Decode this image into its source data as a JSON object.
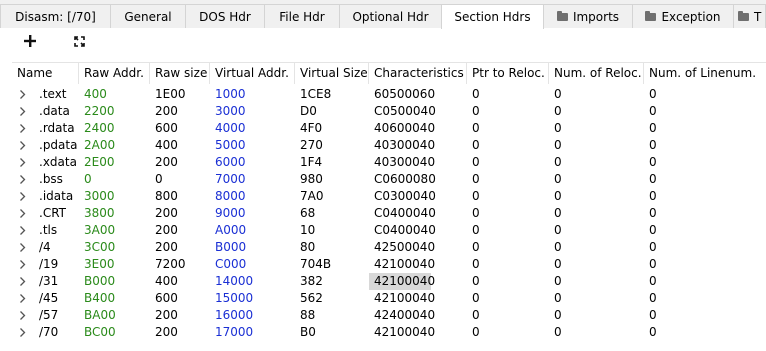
{
  "tabs": [
    {
      "label": "Disasm: [/70]",
      "icon": null,
      "active": false
    },
    {
      "label": "General",
      "icon": null,
      "active": false
    },
    {
      "label": "DOS Hdr",
      "icon": null,
      "active": false
    },
    {
      "label": "File Hdr",
      "icon": null,
      "active": false
    },
    {
      "label": "Optional Hdr",
      "icon": null,
      "active": false
    },
    {
      "label": "Section Hdrs",
      "icon": null,
      "active": true
    },
    {
      "label": "Imports",
      "icon": "folder-icon",
      "active": false
    },
    {
      "label": "Exception",
      "icon": "folder-icon",
      "active": false
    },
    {
      "label": "T",
      "icon": "folder-icon",
      "active": false
    }
  ],
  "toolbar": {
    "add_icon": "plus-icon",
    "fit_icon": "expand-arrows-icon"
  },
  "table": {
    "columns": [
      "Name",
      "Raw Addr.",
      "Raw size",
      "Virtual Addr.",
      "Virtual Size",
      "Characteristics",
      "Ptr to Reloc.",
      "Num. of Reloc.",
      "Num. of Linenum."
    ],
    "rows": [
      [
        ".text",
        "400",
        "1E00",
        "1000",
        "1CE8",
        "60500060",
        "0",
        "0",
        "0"
      ],
      [
        ".data",
        "2200",
        "200",
        "3000",
        "D0",
        "C0500040",
        "0",
        "0",
        "0"
      ],
      [
        ".rdata",
        "2400",
        "600",
        "4000",
        "4F0",
        "40600040",
        "0",
        "0",
        "0"
      ],
      [
        ".pdata",
        "2A00",
        "400",
        "5000",
        "270",
        "40300040",
        "0",
        "0",
        "0"
      ],
      [
        ".xdata",
        "2E00",
        "200",
        "6000",
        "1F4",
        "40300040",
        "0",
        "0",
        "0"
      ],
      [
        ".bss",
        "0",
        "0",
        "7000",
        "980",
        "C0600080",
        "0",
        "0",
        "0"
      ],
      [
        ".idata",
        "3000",
        "800",
        "8000",
        "7A0",
        "C0300040",
        "0",
        "0",
        "0"
      ],
      [
        ".CRT",
        "3800",
        "200",
        "9000",
        "68",
        "C0400040",
        "0",
        "0",
        "0"
      ],
      [
        ".tls",
        "3A00",
        "200",
        "A000",
        "10",
        "C0400040",
        "0",
        "0",
        "0"
      ],
      [
        "/4",
        "3C00",
        "200",
        "B000",
        "80",
        "42500040",
        "0",
        "0",
        "0"
      ],
      [
        "/19",
        "3E00",
        "7200",
        "C000",
        "704B",
        "42100040",
        "0",
        "0",
        "0"
      ],
      [
        "/31",
        "B000",
        "400",
        "14000",
        "382",
        "42100040",
        "0",
        "0",
        "0"
      ],
      [
        "/45",
        "B400",
        "600",
        "15000",
        "562",
        "42100040",
        "0",
        "0",
        "0"
      ],
      [
        "/57",
        "BA00",
        "200",
        "16000",
        "88",
        "42400040",
        "0",
        "0",
        "0"
      ],
      [
        "/70",
        "BC00",
        "200",
        "17000",
        "B0",
        "42100040",
        "0",
        "0",
        "0"
      ]
    ],
    "selected_cell": {
      "row": 11,
      "col": 5
    }
  },
  "colors": {
    "raw_addr": "#2a8a1a",
    "virtual_addr": "#1a2fd4",
    "selected_cell_bg": "#d8d8d8"
  }
}
